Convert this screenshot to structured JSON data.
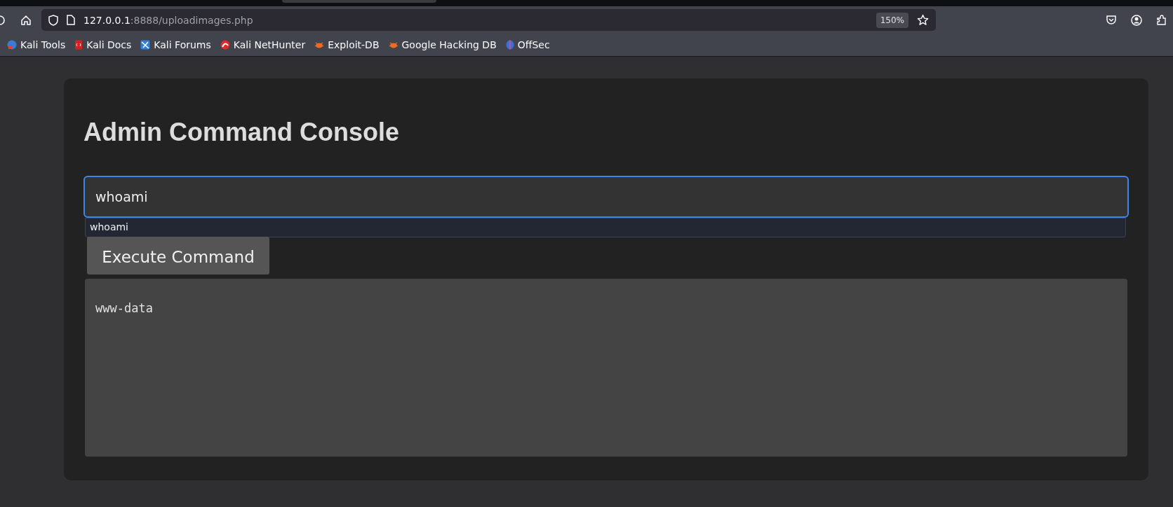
{
  "browser": {
    "url_host": "127.0.0.1",
    "url_path": ":8888/uploadimages.php",
    "zoom": "150%"
  },
  "bookmarks": [
    {
      "label": "Kali Tools",
      "kind": "kali"
    },
    {
      "label": "Kali Docs",
      "kind": "docs"
    },
    {
      "label": "Kali Forums",
      "kind": "forums"
    },
    {
      "label": "Kali NetHunter",
      "kind": "nethunter"
    },
    {
      "label": "Exploit-DB",
      "kind": "exploit"
    },
    {
      "label": "Google Hacking DB",
      "kind": "exploit"
    },
    {
      "label": "OffSec",
      "kind": "offsec"
    }
  ],
  "page": {
    "title": "Admin Command Console",
    "command": "whoami",
    "suggestions": [
      "whoami"
    ],
    "button": "Execute Command",
    "output": "www-data"
  }
}
